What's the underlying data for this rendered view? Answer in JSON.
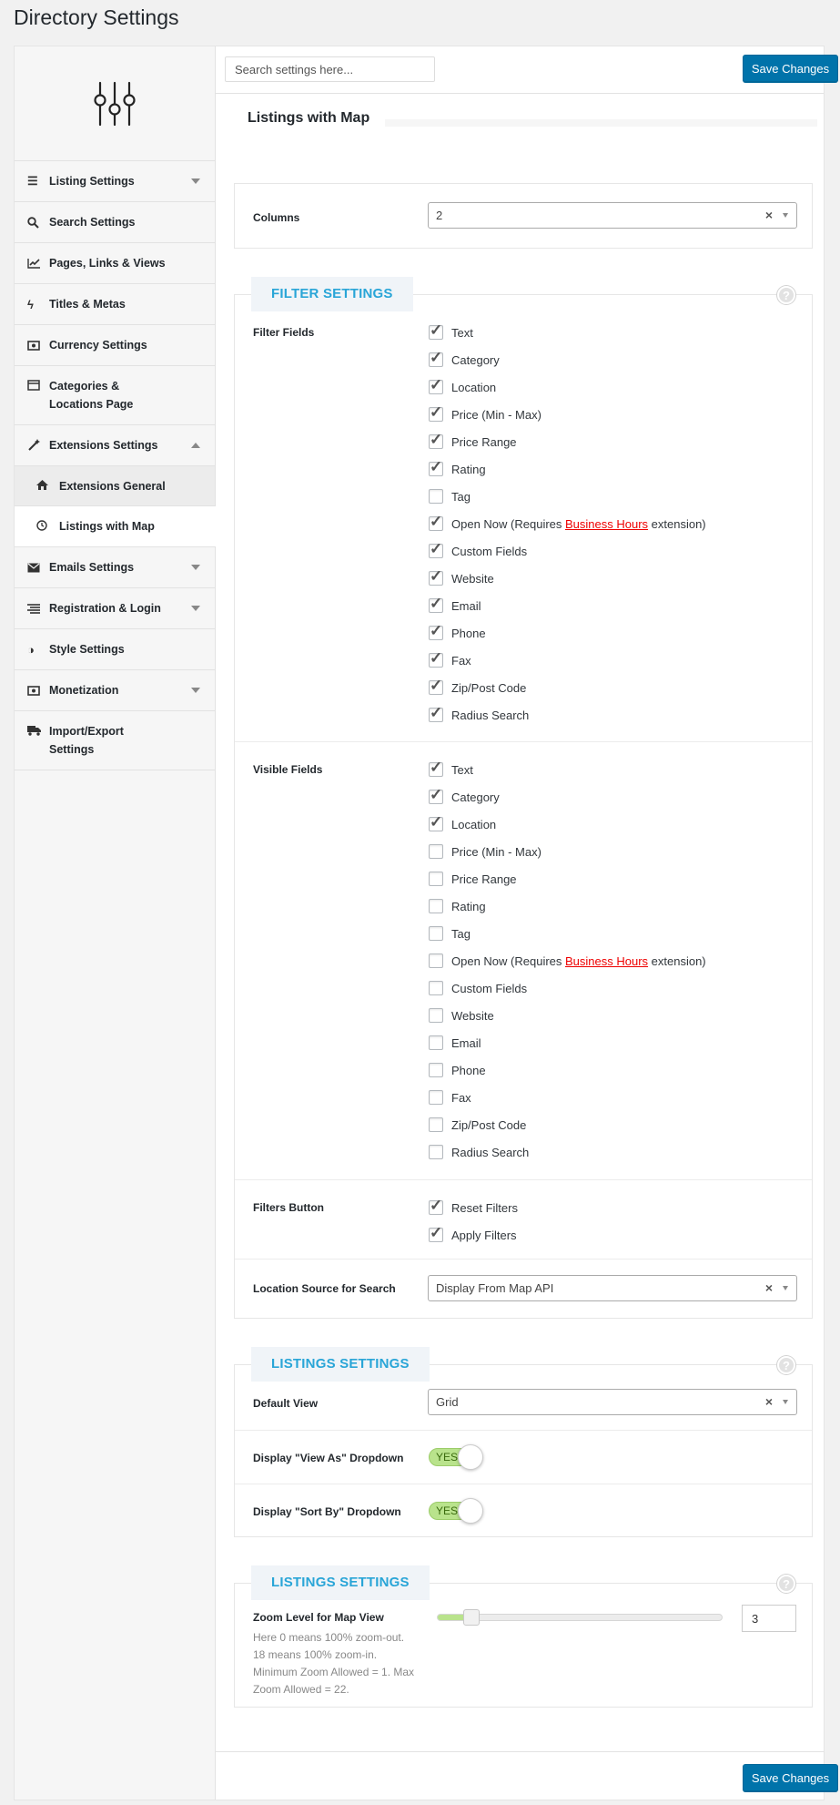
{
  "page_title": "Directory Settings",
  "search": {
    "placeholder": "Search settings here..."
  },
  "save_label": "Save Changes",
  "section_title": "Listings with Map",
  "sidebar": {
    "items": [
      {
        "label": "Listing Settings",
        "icon": "list-icon",
        "caret": "down"
      },
      {
        "label": "Search Settings",
        "icon": "search-icon"
      },
      {
        "label": "Pages, Links & Views",
        "icon": "chart-icon"
      },
      {
        "label": "Titles & Metas",
        "icon": "bolt-icon"
      },
      {
        "label": "Currency Settings",
        "icon": "money-icon"
      },
      {
        "label": "Categories & Locations Page",
        "label_line1": "Categories &",
        "label_line2": "Locations Page",
        "icon": "calendar-icon"
      },
      {
        "label": "Extensions Settings",
        "icon": "wand-icon",
        "caret": "up"
      },
      {
        "label": "Emails Settings",
        "icon": "envelope-icon",
        "caret": "down"
      },
      {
        "label": "Registration & Login",
        "icon": "align-icon",
        "caret": "down"
      },
      {
        "label": "Style Settings",
        "icon": "contrast-icon"
      },
      {
        "label": "Monetization",
        "icon": "money-icon",
        "caret": "down"
      },
      {
        "label": "Import/Export Settings",
        "label_line1": "Import/Export",
        "label_line2": "Settings",
        "icon": "truck-icon"
      }
    ],
    "sub_items": [
      {
        "label": "Extensions General",
        "icon": "home-icon",
        "active": true
      },
      {
        "label": "Listings with Map",
        "icon": "clock-icon",
        "active": false
      }
    ]
  },
  "columns": {
    "label": "Columns",
    "value": "2"
  },
  "filter_settings": {
    "title": "FILTER SETTINGS",
    "filter_fields_label": "Filter Fields",
    "filter_fields": [
      {
        "label": "Text",
        "checked": true
      },
      {
        "label": "Category",
        "checked": true
      },
      {
        "label": "Location",
        "checked": true
      },
      {
        "label": "Price (Min - Max)",
        "checked": true
      },
      {
        "label": "Price Range",
        "checked": true
      },
      {
        "label": "Rating",
        "checked": true
      },
      {
        "label": "Tag",
        "checked": false
      },
      {
        "label": "Open Now (Requires ",
        "link": "Business Hours",
        "suffix": " extension)",
        "checked": true
      },
      {
        "label": "Custom Fields",
        "checked": true
      },
      {
        "label": "Website",
        "checked": true
      },
      {
        "label": "Email",
        "checked": true
      },
      {
        "label": "Phone",
        "checked": true
      },
      {
        "label": "Fax",
        "checked": true
      },
      {
        "label": "Zip/Post Code",
        "checked": true
      },
      {
        "label": "Radius Search",
        "checked": true
      }
    ],
    "visible_fields_label": "Visible Fields",
    "visible_fields": [
      {
        "label": "Text",
        "checked": true
      },
      {
        "label": "Category",
        "checked": true
      },
      {
        "label": "Location",
        "checked": true
      },
      {
        "label": "Price (Min - Max)",
        "checked": false
      },
      {
        "label": "Price Range",
        "checked": false
      },
      {
        "label": "Rating",
        "checked": false
      },
      {
        "label": "Tag",
        "checked": false
      },
      {
        "label": "Open Now (Requires ",
        "link": "Business Hours",
        "suffix": " extension)",
        "checked": false
      },
      {
        "label": "Custom Fields",
        "checked": false
      },
      {
        "label": "Website",
        "checked": false
      },
      {
        "label": "Email",
        "checked": false
      },
      {
        "label": "Phone",
        "checked": false
      },
      {
        "label": "Fax",
        "checked": false
      },
      {
        "label": "Zip/Post Code",
        "checked": false
      },
      {
        "label": "Radius Search",
        "checked": false
      }
    ],
    "filters_button_label": "Filters Button",
    "filters_buttons": [
      {
        "label": "Reset Filters",
        "checked": true
      },
      {
        "label": "Apply Filters",
        "checked": true
      }
    ],
    "location_source_label": "Location Source for Search",
    "location_source_value": "Display From Map API"
  },
  "listings_settings": {
    "title": "LISTINGS SETTINGS",
    "default_view_label": "Default View",
    "default_view_value": "Grid",
    "view_as_label": "Display \"View As\" Dropdown",
    "view_as_value": "YES",
    "sort_by_label": "Display \"Sort By\" Dropdown",
    "sort_by_value": "YES"
  },
  "map_settings": {
    "title": "LISTINGS SETTINGS",
    "zoom_label": "Zoom Level for Map View",
    "zoom_desc": "Here 0 means 100% zoom-out. 18 means 100% zoom-in. Minimum Zoom Allowed = 1. Max Zoom Allowed = 22.",
    "zoom_value": "3",
    "zoom_min": 1,
    "zoom_max": 22
  },
  "help_glyph": "?",
  "colors": {
    "accent": "#0073aa",
    "panel_title": "#29a5d7",
    "toggle_on": "#b9e38c",
    "link": "#ee0000"
  }
}
